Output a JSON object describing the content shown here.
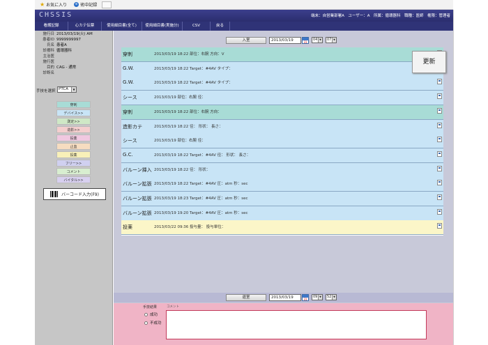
{
  "browser": {
    "favorites_label": "お気に入り",
    "tab_label": "術中記録"
  },
  "header": {
    "app_logo": "CHSSIS",
    "user_info": "端末：自営業部署A　ユーザー：A　所属：循環器科　職種：医師　権限：管理者"
  },
  "menu": [
    {
      "label": "看護記録",
      "w": 48
    },
    {
      "label": "心カテ伝票",
      "w": 48
    },
    {
      "label": "使用細目書(全て)",
      "w": 58
    },
    {
      "label": "使用細目書(実施分)",
      "w": 58
    },
    {
      "label": "CSV",
      "w": 40
    },
    {
      "label": "戻る",
      "w": 28
    }
  ],
  "patient_info": [
    {
      "label": "施行日",
      "value": "2013/03/19(火) AM"
    },
    {
      "label": "患者ID",
      "value": "9999999997"
    },
    {
      "label": "氏名",
      "value": "患者A"
    },
    {
      "label": "診療科",
      "value": "循環器科"
    },
    {
      "label": "主治医",
      "value": ""
    },
    {
      "label": "施行医",
      "value": ""
    },
    {
      "label": "目的",
      "value": "CAG - 通常"
    },
    {
      "label": "診断名",
      "value": ""
    }
  ],
  "procedure_select": {
    "label": "手技を選択",
    "value": "PTCA"
  },
  "categories": [
    {
      "label": "穿刺",
      "color": "#a8dcd6"
    },
    {
      "label": "デバイス>>",
      "color": "#c8e4f6"
    },
    {
      "label": "測定>>",
      "color": "#cfe8c6"
    },
    {
      "label": "造影>>",
      "color": "#f4cece"
    },
    {
      "label": "投薬",
      "color": "#f0c8e0"
    },
    {
      "label": "止血",
      "color": "#f6dcc0"
    },
    {
      "label": "投薬",
      "color": "#f8f0b8"
    },
    {
      "label": "フリー>>",
      "color": "#d0d0f0"
    },
    {
      "label": "コメント",
      "color": "#d8eed0"
    },
    {
      "label": "バイタル>>",
      "color": "#d8d0f0"
    }
  ],
  "barcode_button": {
    "label": "バーコード入力(F9)"
  },
  "top_nav": {
    "button_label": "入室",
    "date": "2013/03/19",
    "hour": "04",
    "minute": "07"
  },
  "update_button": {
    "label": "更新"
  },
  "records": [
    {
      "title": "穿刺",
      "detail": "2013/03/19 18:22 部位：右腕 方向：V",
      "color": "#a8dcd6"
    },
    {
      "title": "G.W.",
      "detail": "2013/03/19 18:22 Target：#4AV タイプ：",
      "color": "#c8e4f6"
    },
    {
      "title": "G.W.",
      "detail": "2013/03/19 18:22 Target：#4AV タイプ：",
      "color": "#c8e4f6"
    },
    {
      "title": "シース",
      "detail": "2013/03/19 部位：右腕 径：",
      "color": "#c8e4f6"
    },
    {
      "title": "穿刺",
      "detail": "2013/03/19 18:22 部位：右腕 方向：",
      "color": "#a8dcd6"
    },
    {
      "title": "造影カテ",
      "detail": "2013/03/19 18:22 径： 形状： 長さ：",
      "color": "#c8e4f6"
    },
    {
      "title": "シース",
      "detail": "2013/03/19 部位：右腕 径：",
      "color": "#c8e4f6"
    },
    {
      "title": "G.C.",
      "detail": "2013/03/19 18:22 Target：#4AV 径： 形状： 長さ：",
      "color": "#c8e4f6"
    },
    {
      "title": "バルーン挿入",
      "detail": "2013/03/19 18:22 径： 形状：",
      "color": "#c8e4f6"
    },
    {
      "title": "バルーン拡張",
      "detail": "2013/03/19 18:22 Target：#4AV 圧：atm 秒：sec",
      "color": "#c8e4f6"
    },
    {
      "title": "バルーン拡張",
      "detail": "2013/03/19 18:23 Target：#4AV 圧：atm 秒：sec",
      "color": "#c8e4f6"
    },
    {
      "title": "バルーン拡張",
      "detail": "2013/03/19 19:20 Target：#4AV 圧：atm 秒：sec",
      "color": "#c8e4f6"
    },
    {
      "title": "投薬",
      "detail": "2013/03/22 09:36 投与量： 投与単位：",
      "color": "#fbf6c8"
    }
  ],
  "bottom_nav": {
    "button_label": "退室",
    "date": "2013/03/19",
    "hour": "09",
    "minute": "52"
  },
  "result_form": {
    "label": "手技結果",
    "comment_label": "コメント",
    "options": [
      "成功",
      "不成功"
    ]
  }
}
